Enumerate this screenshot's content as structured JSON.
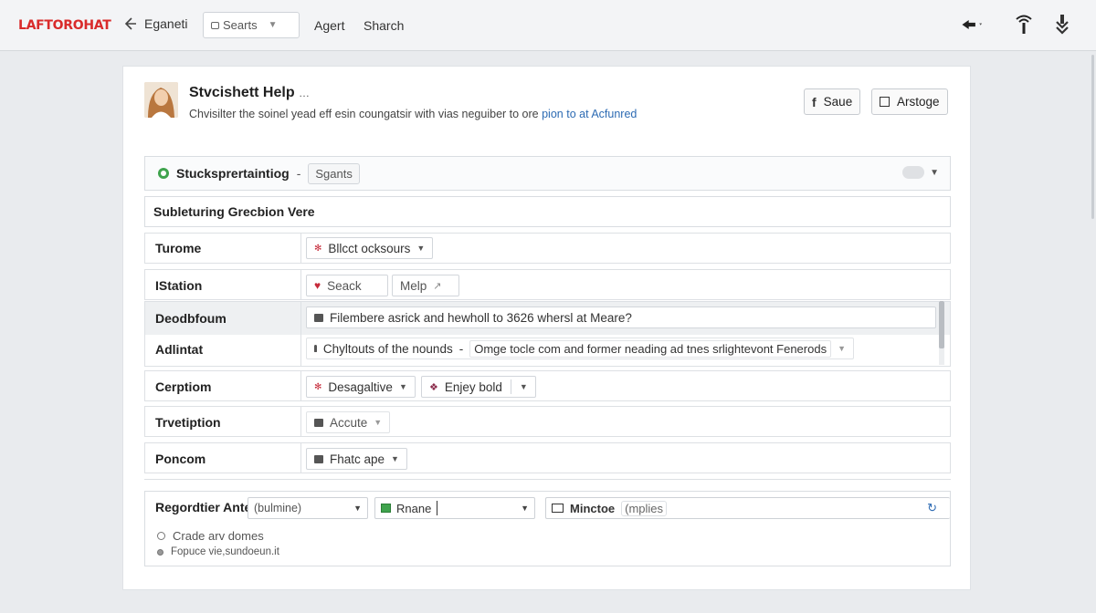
{
  "app": {
    "logo": "LAFTOROHAT",
    "nav_back_label": "Eganeti",
    "search_value": "Searts",
    "nav_links": [
      "Agert",
      "Sharch"
    ]
  },
  "header": {
    "title": "Stvcishett Help",
    "title_suffix": "…",
    "subtitle": "Chvisilter the soinel yead eff esin coungatsir with vias neguiber to ore",
    "subtitle_link": "pion to at Acfunred",
    "save_label": "Saue",
    "arstoge_label": "Arstoge"
  },
  "section": {
    "title": "Stucksprertaintiog",
    "separator": "-",
    "chip": "Sgants"
  },
  "subsection_title": "Subleturing Grecbion Vere",
  "rows": [
    {
      "label": "Turome",
      "controls": [
        {
          "text": "Bllcct ocksours",
          "caret": "▼"
        }
      ]
    },
    {
      "label": "IStation",
      "controls": [
        {
          "text": "Seack"
        },
        {
          "text": "Melp",
          "suffix": "↗"
        }
      ]
    },
    {
      "label": "Deodbfoum",
      "controls": [
        {
          "text": "Filembere asrick and hewholl to 3626 whersl at Meare?"
        }
      ]
    },
    {
      "label": "Adlintat",
      "controls": [
        {
          "text": "Chyltouts of the nounds",
          "separator": "-",
          "text2": "Omge tocle com and former neading ad tnes srlightevont Fenerods",
          "caret": "▼"
        }
      ]
    },
    {
      "label": "Cerptiom",
      "controls": [
        {
          "text": "Desagaltive",
          "caret": "▼"
        },
        {
          "text": "Enjey bold",
          "caret": "▼"
        }
      ]
    },
    {
      "label": "Trvetiption",
      "controls": [
        {
          "text": "Accute",
          "caret": "▼"
        }
      ]
    },
    {
      "label": "Poncom",
      "controls": [
        {
          "text": "Fhatc ape",
          "caret": "▼"
        }
      ]
    }
  ],
  "footer": {
    "label": "Regordtier Ante",
    "select1": "(bulmine)",
    "select2": "Rnane",
    "chip_label": "Minctoe",
    "chip_value": "(mplies",
    "options": [
      "Crade arv domes",
      "Fopuce vie,sundoeun.it"
    ]
  },
  "colors": {
    "logo": "#d92b2b",
    "link": "#2d6bb3",
    "status_ok": "#3fa34d",
    "heart": "#c62b3a"
  }
}
